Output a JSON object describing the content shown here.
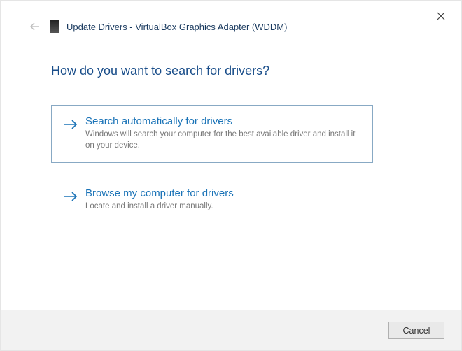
{
  "window": {
    "title": "Update Drivers - VirtualBox Graphics Adapter (WDDM)"
  },
  "content": {
    "question": "How do you want to search for drivers?",
    "options": [
      {
        "title": "Search automatically for drivers",
        "description": "Windows will search your computer for the best available driver and install it on your device."
      },
      {
        "title": "Browse my computer for drivers",
        "description": "Locate and install a driver manually."
      }
    ]
  },
  "footer": {
    "cancel_label": "Cancel"
  }
}
